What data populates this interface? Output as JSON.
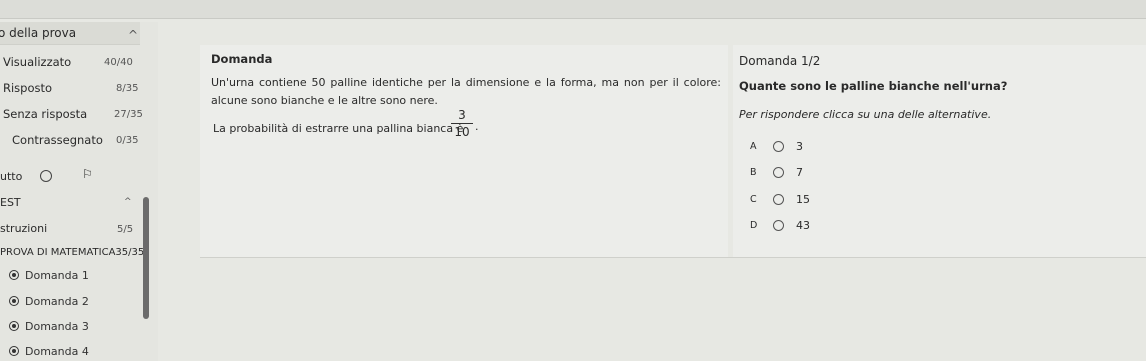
{
  "sidebar": {
    "header": "o della prova",
    "stats": [
      {
        "label": "Visualizzato",
        "value": "40/40"
      },
      {
        "label": "Risposto",
        "value": "8/35"
      },
      {
        "label": "Senza risposta",
        "value": "27/35"
      },
      {
        "label": "Contrassegnato",
        "value": "0/35"
      }
    ],
    "tools_label": "utto",
    "test_label": "EST",
    "istruzioni_label": "struzioni",
    "istruzioni_value": "5/5",
    "section_label": "PROVA DI MATEMATICA35/35",
    "nav_items": [
      "Domanda 1",
      "Domanda 2",
      "Domanda 3",
      "Domanda 4"
    ]
  },
  "question": {
    "title": "Domanda",
    "text": "Un'urna contiene 50 palline identiche per la dimensione e la forma, ma non per il colore: alcune sono bianche e le altre sono nere.",
    "prob_text": "La probabilità di estrarre una pallina bianca è",
    "frac_num": "3",
    "frac_den": "10",
    "frac_end": "."
  },
  "answer": {
    "title": "Domanda 1/2",
    "question": "Quante sono le palline bianche nell'urna?",
    "instructions": "Per rispondere clicca su una delle alternative.",
    "options": [
      {
        "letter": "A",
        "value": "3"
      },
      {
        "letter": "B",
        "value": "7"
      },
      {
        "letter": "C",
        "value": "15"
      },
      {
        "letter": "D",
        "value": "43"
      }
    ]
  }
}
